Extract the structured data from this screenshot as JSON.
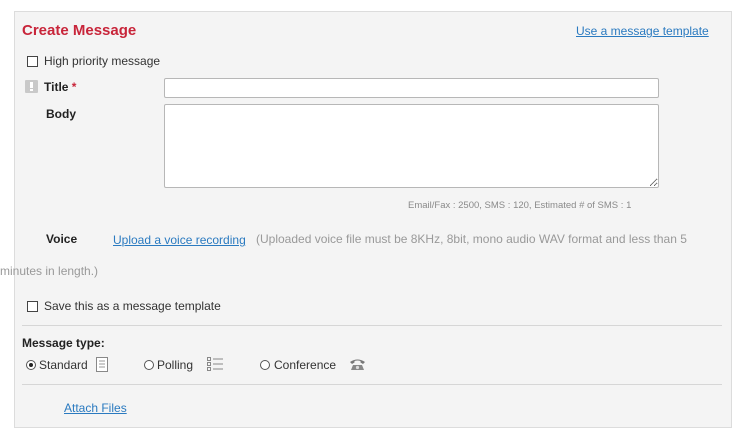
{
  "header": {
    "title": "Create Message",
    "template_link": "Use a message template"
  },
  "options": {
    "high_priority_label": "High priority message",
    "save_template_label": "Save this as a message template"
  },
  "form": {
    "title_label": "Title",
    "required_mark": "*",
    "title_value": "",
    "body_label": "Body",
    "body_value": "",
    "char_limits": "Email/Fax : 2500, SMS : 120, Estimated # of SMS : 1",
    "voice_label": "Voice",
    "voice_upload_link": "Upload a voice recording",
    "voice_note_1": "(Uploaded voice file must be 8KHz, 8bit, mono audio WAV format and less than 5",
    "voice_note_2": "minutes in length.)"
  },
  "message_type": {
    "heading": "Message type:",
    "options": [
      {
        "label": "Standard",
        "icon": "document-icon",
        "selected": true
      },
      {
        "label": "Polling",
        "icon": "list-icon",
        "selected": false
      },
      {
        "label": "Conference",
        "icon": "telephone-icon",
        "selected": false
      }
    ]
  },
  "attach": {
    "link": "Attach Files"
  },
  "colors": {
    "accent": "#c8253a",
    "link": "#2a7ac0"
  }
}
